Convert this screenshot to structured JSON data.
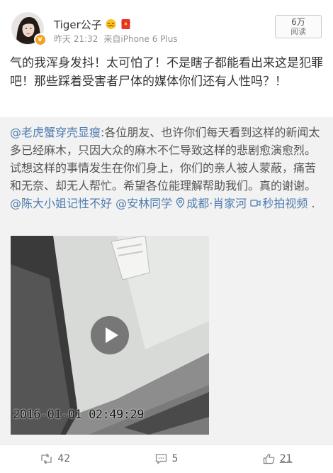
{
  "header": {
    "username": "Tiger公子",
    "time": "昨天 21:32",
    "source": "来自iPhone 6 Plus",
    "views_count": "6万",
    "views_label": "阅读"
  },
  "post": {
    "text": "气的我浑身发抖！太可怕了！不是瞎子都能看出来这是犯罪吧！那些踩着受害者尸体的媒体你们还有人性吗？！"
  },
  "repost": {
    "author": "@老虎蟹穿壳显瘦",
    "body": ":各位朋友、也许你们每天看到这样的新闻太多已经麻木，只因大众的麻木不仁导致这样的悲剧愈演愈烈。试想这样的事情发生在你们身上，你们的亲人被人蒙蔽，痛苦和无奈、却无人帮忙。希望各位能理解帮助我们。真的谢谢。",
    "mention1": "@陈大小姐记性不好",
    "mention2": "@安林同学",
    "location": "成都·肖家河",
    "video_link": "秒拍视频",
    "end_punct": ".",
    "video_timestamp": "2016-01-01 02:49:29"
  },
  "actions": {
    "repost_count": "42",
    "comment_count": "5",
    "like_count": "21"
  },
  "colors": {
    "link": "#507daf",
    "repost_bg": "#f2f2f2",
    "vip": "#f4a11f"
  }
}
